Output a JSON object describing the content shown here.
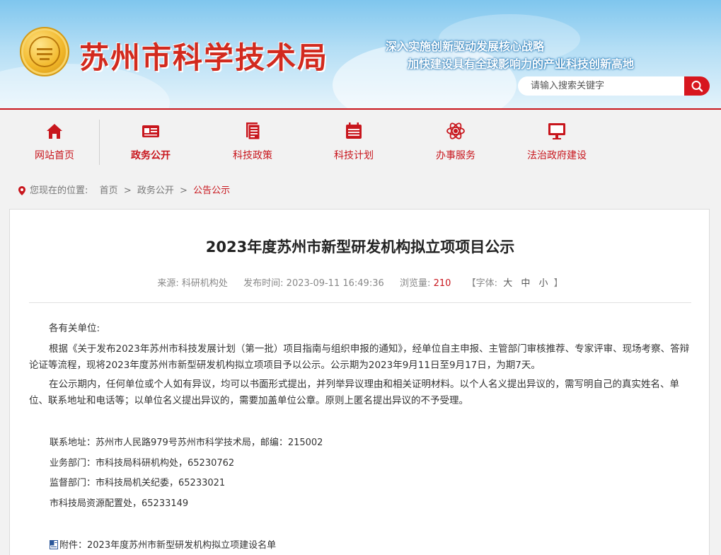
{
  "header": {
    "site_title": "苏州市科学技术局",
    "slogan_1": "深入实施创新驱动发展核心战略",
    "slogan_2": "加快建设具有全球影响力的产业科技创新高地",
    "search_placeholder": "请输入搜索关键字"
  },
  "nav": {
    "items": [
      {
        "label": "网站首页",
        "icon": "home-icon"
      },
      {
        "label": "政务公开",
        "icon": "id-card-icon"
      },
      {
        "label": "科技政策",
        "icon": "document-icon"
      },
      {
        "label": "科技计划",
        "icon": "calendar-icon"
      },
      {
        "label": "办事服务",
        "icon": "atom-icon"
      },
      {
        "label": "法治政府建设",
        "icon": "monitor-icon"
      }
    ],
    "active_index": 1
  },
  "breadcrumb": {
    "prefix": "您现在的位置:",
    "items": [
      "首页",
      "政务公开",
      "公告公示"
    ],
    "separator": ">"
  },
  "article": {
    "title": "2023年度苏州市新型研发机构拟立项项目公示",
    "meta": {
      "source_label": "来源:",
      "source": "科研机构处",
      "time_label": "发布时间:",
      "time": "2023-09-11 16:49:36",
      "views_label": "浏览量:",
      "views": "210",
      "font_label": "【字体:",
      "font_large": "大",
      "font_medium": "中",
      "font_small": "小",
      "font_end": "】"
    },
    "greeting": "各有关单位:",
    "paragraph_1": "根据《关于发布2023年苏州市科技发展计划（第一批）项目指南与组织申报的通知》，经单位自主申报、主管部门审核推荐、专家评审、现场考察、答辩论证等流程，现将2023年度苏州市新型研发机构拟立项项目予以公示。公示期为2023年9月11日至9月17日，为期7天。",
    "paragraph_2": "在公示期内，任何单位或个人如有异议，均可以书面形式提出，并列举异议理由和相关证明材料。以个人名义提出异议的，需写明自己的真实姓名、单位、联系地址和电话等；以单位名义提出异议的，需要加盖单位公章。原则上匿名提出异议的不予受理。",
    "contact_address": "联系地址：苏州市人民路979号苏州市科学技术局，邮编：215002",
    "business_dept": "业务部门：市科技局科研机构处，65230762",
    "supervision_dept": "监督部门：市科技局机关纪委，65233021",
    "resource_dept": "市科技局资源配置处，65233149",
    "attachment": "附件：2023年度苏州市新型研发机构拟立项建设名单"
  },
  "colors": {
    "brand_red": "#c8161d",
    "header_blue": "#7fc6ee",
    "emblem_gold": "#f2b82a"
  }
}
